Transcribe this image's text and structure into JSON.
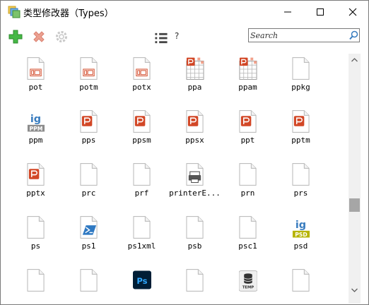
{
  "window": {
    "title": "类型修改器（Types）"
  },
  "toolbar": {
    "add_icon": "plus-icon",
    "delete_icon": "x-icon",
    "settings_icon": "gear-icon",
    "view_icon": "list-view-icon",
    "help_label": "?"
  },
  "search": {
    "placeholder": "Search",
    "value": ""
  },
  "colors": {
    "add_green": "#3fb33f",
    "delete_red": "#e08a7a",
    "office_orange": "#d24726",
    "photoshop_blue": "#31a8ff"
  },
  "items": [
    {
      "label": "pot",
      "icon": "potx-template-icon"
    },
    {
      "label": "potm",
      "icon": "potx-template-icon"
    },
    {
      "label": "potx",
      "icon": "potx-template-icon"
    },
    {
      "label": "ppa",
      "icon": "ppa-addin-icon"
    },
    {
      "label": "ppam",
      "icon": "ppa-addin-icon"
    },
    {
      "label": "ppkg",
      "icon": "blank-file-icon"
    },
    {
      "label": "ppm",
      "icon": "ppm-image-icon"
    },
    {
      "label": "pps",
      "icon": "powerpoint-file-icon"
    },
    {
      "label": "ppsm",
      "icon": "powerpoint-file-icon"
    },
    {
      "label": "ppsx",
      "icon": "powerpoint-file-icon"
    },
    {
      "label": "ppt",
      "icon": "powerpoint-file-icon"
    },
    {
      "label": "pptm",
      "icon": "powerpoint-file-icon"
    },
    {
      "label": "pptx",
      "icon": "powerpoint-file-icon"
    },
    {
      "label": "prc",
      "icon": "blank-file-icon"
    },
    {
      "label": "prf",
      "icon": "blank-file-icon"
    },
    {
      "label": "printerE...",
      "icon": "printer-file-icon"
    },
    {
      "label": "prn",
      "icon": "blank-file-icon"
    },
    {
      "label": "prs",
      "icon": "blank-file-icon"
    },
    {
      "label": "ps",
      "icon": "blank-file-icon"
    },
    {
      "label": "ps1",
      "icon": "powershell-script-icon"
    },
    {
      "label": "ps1xml",
      "icon": "blank-file-icon"
    },
    {
      "label": "psb",
      "icon": "blank-file-icon"
    },
    {
      "label": "psc1",
      "icon": "blank-file-icon"
    },
    {
      "label": "psd",
      "icon": "psd-image-icon"
    },
    {
      "label": "",
      "icon": "blank-file-icon"
    },
    {
      "label": "",
      "icon": "blank-file-icon"
    },
    {
      "label": "",
      "icon": "photoshop-icon"
    },
    {
      "label": "",
      "icon": "blank-file-icon"
    },
    {
      "label": "",
      "icon": "database-temp-icon"
    },
    {
      "label": "",
      "icon": "blank-file-icon"
    }
  ]
}
